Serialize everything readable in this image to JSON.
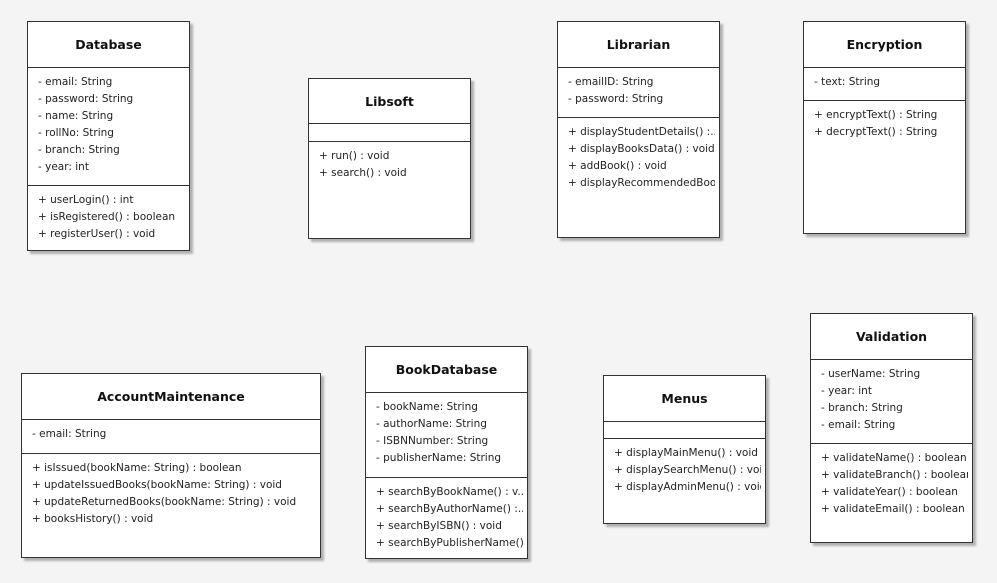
{
  "classes": {
    "database": {
      "name": "Database",
      "attributes": [
        "- email: String",
        "- password: String",
        "- name: String",
        "- rollNo: String",
        "- branch: String",
        "- year: int"
      ],
      "operations": [
        "+ userLogin() : int",
        "+ isRegistered() : boolean",
        "+ registerUser() : void"
      ]
    },
    "libsoft": {
      "name": "Libsoft",
      "attributes": [],
      "operations": [
        "+ run() : void",
        "+ search() : void"
      ]
    },
    "librarian": {
      "name": "Librarian",
      "attributes": [
        "- emailID: String",
        "- password: String"
      ],
      "operations": [
        "+ displayStudentDetails() :...",
        "+ displayBooksData() : void",
        "+ addBook() : void",
        "+ displayRecommendedBoo..."
      ]
    },
    "encryption": {
      "name": "Encryption",
      "attributes": [
        "- text: String"
      ],
      "operations": [
        "+ encryptText() : String",
        "+ decryptText() : String"
      ]
    },
    "account_maintenance": {
      "name": "AccountMaintenance",
      "attributes": [
        "- email: String"
      ],
      "operations": [
        "+ isIssued(bookName: String) : boolean",
        "+ updateIssuedBooks(bookName: String) : void",
        "+ updateReturnedBooks(bookName: String) : void",
        "+ booksHistory() : void"
      ]
    },
    "book_database": {
      "name": "BookDatabase",
      "attributes": [
        "- bookName: String",
        "- authorName: String",
        "- ISBNNumber: String",
        "- publisherName: String"
      ],
      "operations": [
        "+ searchByBookName() : v...",
        "+ searchByAuthorName() :...",
        "+ searchByISBN() : void",
        "+ searchByPublisherName()..."
      ]
    },
    "menus": {
      "name": "Menus",
      "attributes": [],
      "operations": [
        "+ displayMainMenu() : void",
        "+ displaySearchMenu() : void",
        "+ displayAdminMenu() : void"
      ]
    },
    "validation": {
      "name": "Validation",
      "attributes": [
        "- userName: String",
        "- year: int",
        "- branch: String",
        "- email: String"
      ],
      "operations": [
        "+ validateName() : boolean",
        "+ validateBranch() : boolean",
        "+ validateYear() : boolean",
        "+ validateEmail() : boolean"
      ]
    }
  }
}
